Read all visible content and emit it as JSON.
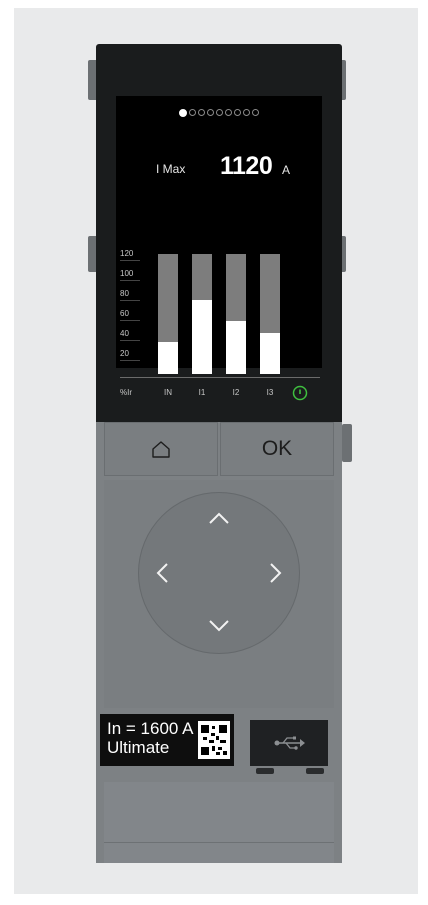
{
  "display": {
    "page_dots": 9,
    "active_page": 1,
    "reading_label": "I Max",
    "reading_value": "1120",
    "reading_unit": "A"
  },
  "chart_data": {
    "type": "bar",
    "categories": [
      "IN",
      "I1",
      "I2",
      "I3"
    ],
    "y_ticks": [
      "120",
      "100",
      "80",
      "60",
      "40",
      "20"
    ],
    "y_axis_label": "%Ir",
    "ylim": [
      0,
      120
    ],
    "values": [
      32,
      74,
      53,
      41
    ],
    "colors": {
      "fill": "#ffffff",
      "track": "#7d7d7d"
    }
  },
  "keys": {
    "home_icon": "home-icon",
    "ok_label": "OK",
    "dpad_icons": [
      "up-arrow-icon",
      "left-arrow-icon",
      "right-arrow-icon",
      "down-arrow-icon"
    ]
  },
  "rating_plate": {
    "line1": "In = 1600 A",
    "line2": "Ultimate"
  },
  "usb_icon": "usb-icon",
  "colors": {
    "power_indicator": "#3fbf3f",
    "bezel": "#1a1c1d",
    "body": "#7d8184"
  }
}
